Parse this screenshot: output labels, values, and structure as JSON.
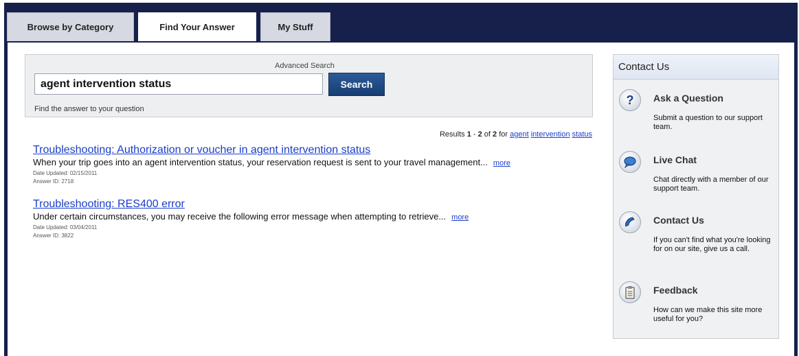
{
  "tabs": [
    {
      "label": "Browse by Category",
      "active": false
    },
    {
      "label": "Find Your Answer",
      "active": true
    },
    {
      "label": "My Stuff",
      "active": false
    }
  ],
  "search": {
    "advanced_label": "Advanced Search",
    "query": "agent intervention status",
    "button_label": "Search",
    "help_text": "Find the answer to your question"
  },
  "results_summary": {
    "prefix": "Results ",
    "start": "1",
    "dash": " - ",
    "end": "2",
    "of": " of ",
    "total": "2",
    "for": " for ",
    "terms": [
      "agent",
      "intervention",
      "status"
    ]
  },
  "results": [
    {
      "title": "Troubleshooting: Authorization or voucher in agent intervention status",
      "snippet": "When your trip goes into an agent intervention status, your reservation request is sent to your travel management...",
      "more": "more",
      "date": "Date Updated: 02/15/2011",
      "answer_id": "Answer ID: 2718"
    },
    {
      "title": "Troubleshooting: RES400 error",
      "snippet": "Under certain circumstances, you may receive the following error message when attempting to retrieve...",
      "more": "more",
      "date": "Date Updated: 03/04/2011",
      "answer_id": "Answer ID: 3822"
    }
  ],
  "contact": {
    "heading": "Contact Us",
    "items": [
      {
        "icon": "question-icon",
        "title": "Ask a Question",
        "desc": "Submit a question to our support team."
      },
      {
        "icon": "chat-bubble-icon",
        "title": "Live Chat",
        "desc": "Chat directly with a member of our support team."
      },
      {
        "icon": "phone-icon",
        "title": "Contact Us",
        "desc": "If you can't find what you're looking for on our site, give us a call."
      },
      {
        "icon": "clipboard-icon",
        "title": "Feedback",
        "desc": "How can we make this site more useful for you?"
      }
    ]
  },
  "colors": {
    "frame": "#16204a",
    "link": "#1a3ec8",
    "button": "#1f4a86"
  }
}
